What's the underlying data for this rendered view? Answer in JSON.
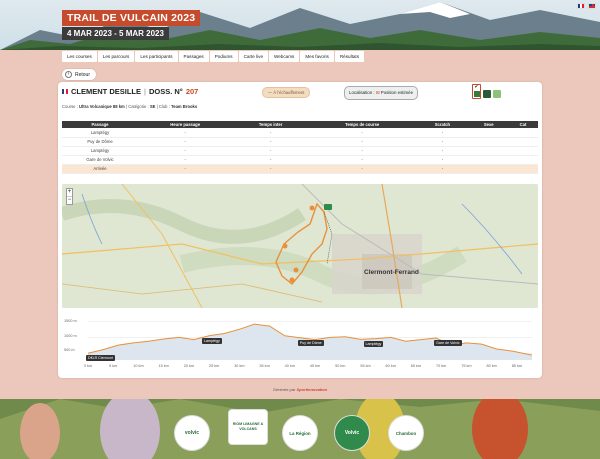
{
  "header": {
    "event_title": "TRAIL DE VULCAIN 2023",
    "event_dates": "4 MAR 2023 - 5 MAR 2023",
    "languages": [
      "fr",
      "en"
    ]
  },
  "nav": {
    "items": [
      "Les courses",
      "Les parcours",
      "Les participants",
      "Passages",
      "Podiums",
      "Carte live",
      "Webcams",
      "Mes favoris",
      "Résultats"
    ]
  },
  "back_label": "Retour",
  "runner": {
    "name": "CLEMENT DESILLE",
    "dossard_label": "DOSS. N°",
    "dossard_number": "207",
    "course_label": "Course :",
    "course_value": "Ultra Volcanique 88 km",
    "category_label": "Catégorie :",
    "category_value": "SE",
    "club_label": "Club :",
    "club_value": "Team Brooks"
  },
  "buttons": {
    "live": "— À l'échauffement",
    "localisation_label": "Localisation :",
    "localisation_value": "Position estimée"
  },
  "table": {
    "headers": [
      "Passage",
      "Heure passage",
      "Temps inter",
      "Temps de course",
      "Scratch",
      "Sexe",
      "Cat"
    ],
    "rows": [
      [
        "Lamptégy",
        "-",
        "-",
        "-",
        "-",
        "",
        ""
      ],
      [
        "Puy de Dôme",
        "-",
        "-",
        "-",
        "-",
        "",
        ""
      ],
      [
        "Lamptégy",
        "-",
        "-",
        "-",
        "-",
        "",
        ""
      ],
      [
        "Gare de Volvic",
        "-",
        "-",
        "-",
        "-",
        "",
        ""
      ],
      [
        "Arrivée",
        "-",
        "-",
        "-",
        "-",
        "",
        ""
      ]
    ]
  },
  "map": {
    "city_label": "Clermont-Ferrand",
    "zoom_in": "+",
    "zoom_out": "−"
  },
  "chart_data": {
    "type": "area",
    "x_unit": "km",
    "x_ticks": [
      "0 km",
      "5 km",
      "10 km",
      "15 km",
      "20 km",
      "25 km",
      "30 km",
      "35 km",
      "40 km",
      "45 km",
      "50 km",
      "55 km",
      "60 km",
      "65 km",
      "70 km",
      "75 km",
      "80 km",
      "85 km"
    ],
    "y_ticks": [
      "1500 m",
      "1000 m",
      "500 m"
    ],
    "ylim": [
      300,
      1600
    ],
    "xlim": [
      0,
      88
    ],
    "x": [
      0,
      3,
      6,
      9,
      12,
      15,
      18,
      21,
      24,
      27,
      30,
      33,
      36,
      39,
      42,
      45,
      48,
      51,
      54,
      57,
      60,
      63,
      66,
      69,
      72,
      75,
      78,
      81,
      84,
      88
    ],
    "y": [
      510,
      620,
      760,
      830,
      880,
      950,
      1000,
      930,
      1050,
      1120,
      1250,
      1410,
      1350,
      1050,
      990,
      930,
      1000,
      1020,
      940,
      960,
      1000,
      880,
      930,
      980,
      760,
      830,
      790,
      640,
      580,
      450
    ],
    "checkpoints": [
      {
        "name": "D€LR Clermont",
        "x": 0
      },
      {
        "name": "Lamptégy",
        "x": 23
      },
      {
        "name": "Puy de Dôme",
        "x": 42
      },
      {
        "name": "Lamptégy",
        "x": 55
      },
      {
        "name": "Gare de Volvic",
        "x": 69
      }
    ],
    "color": "#e8913a"
  },
  "footer": {
    "generated_label": "Générée par",
    "generated_brand": "Sportinnovation",
    "sponsors": [
      "volvic",
      "RIOM LIMAGNE & VOLCANS",
      "La Région",
      "Volvic",
      "Chambon"
    ]
  },
  "colors": {
    "accent": "#c64a2c",
    "background": "#ecc8bc",
    "header_dark": "#3a3a3a",
    "highlight_row": "#fbe6d4"
  }
}
